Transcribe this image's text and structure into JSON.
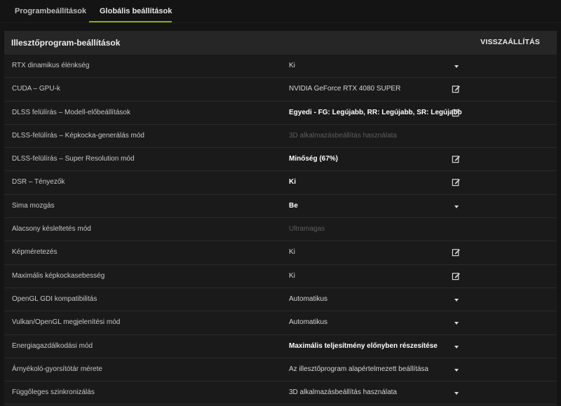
{
  "tabs": [
    {
      "label": "Programbeállítások",
      "active": false
    },
    {
      "label": "Globális beállítások",
      "active": true
    }
  ],
  "colors": {
    "accent": "#76b900",
    "background": "#141414",
    "panel": "#1a1a1a",
    "header": "#262626"
  },
  "panel": {
    "title": "Illesztőprogram-beállítások",
    "reset_label": "VISSZAÁLLÍTÁS"
  },
  "settings": [
    {
      "label": "RTX dinamikus élénkség",
      "value": "Ki",
      "style": "normal",
      "control": "dropdown"
    },
    {
      "label": "CUDA – GPU-k",
      "value": "NVIDIA GeForce RTX 4080 SUPER",
      "style": "normal",
      "control": "edit-icon"
    },
    {
      "label": "DLSS felülírás – Modell-előbeállítások",
      "value": "Egyedi - FG: Legújabb, RR: Legújabb, SR: Legújabb",
      "style": "bold",
      "control": "edit-icon"
    },
    {
      "label": "DLSS-felülírás – Képkocka-generálás mód",
      "value": "3D alkalmazásbeállítás használata",
      "style": "disabled",
      "control": "none"
    },
    {
      "label": "DLSS-felülírás – Super Resolution mód",
      "value": "Minőség (67%)",
      "style": "bold",
      "control": "edit-icon"
    },
    {
      "label": "DSR – Tényezők",
      "value": "Ki",
      "style": "bold",
      "control": "edit-icon"
    },
    {
      "label": "Sima mozgás",
      "value": "Be",
      "style": "bold",
      "control": "dropdown"
    },
    {
      "label": "Alacsony késleltetés mód",
      "value": "Ultramagas",
      "style": "disabled",
      "control": "none"
    },
    {
      "label": "Képméretezés",
      "value": "Ki",
      "style": "normal",
      "control": "edit-icon"
    },
    {
      "label": "Maximális képkockasebesség",
      "value": "Ki",
      "style": "normal",
      "control": "edit-icon"
    },
    {
      "label": "OpenGL GDI kompatibilitás",
      "value": "Automatikus",
      "style": "normal",
      "control": "dropdown"
    },
    {
      "label": "Vulkan/OpenGL megjelenítési mód",
      "value": "Automatikus",
      "style": "normal",
      "control": "dropdown"
    },
    {
      "label": "Energiagazdálkodási mód",
      "value": "Maximális teljesítmény előnyben részesítése",
      "style": "bold",
      "control": "dropdown"
    },
    {
      "label": "Árnyékoló-gyorsítótár mérete",
      "value": "Az illesztőprogram alapértelmezett beállítása",
      "style": "normal",
      "control": "dropdown"
    },
    {
      "label": "Függőleges szinkronizálás",
      "value": "3D alkalmazásbeállítás használata",
      "style": "normal",
      "control": "dropdown"
    }
  ]
}
